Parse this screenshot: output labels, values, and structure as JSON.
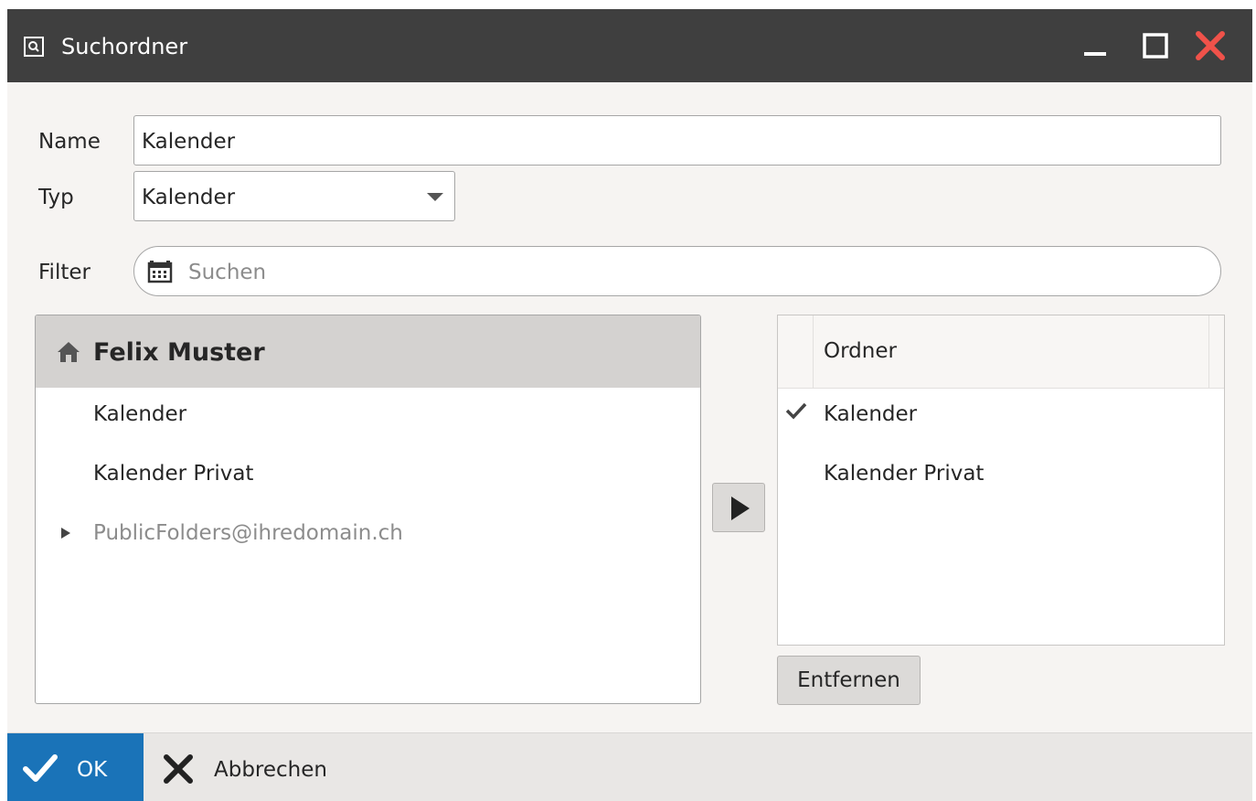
{
  "window": {
    "title": "Suchordner",
    "icon": "search-folder-icon",
    "controls": [
      "minimize-icon",
      "maximize-icon",
      "close-icon"
    ],
    "colors": {
      "titlebar": "#3f3f3f",
      "close": "#f0524a",
      "accent": "#1a73b8"
    }
  },
  "form": {
    "name_label": "Name",
    "name_value": "Kalender",
    "type_label": "Typ",
    "type_value": "Kalender",
    "filter_label": "Filter",
    "filter_placeholder": "Suchen",
    "filter_icon": "calendar-icon"
  },
  "tree": {
    "root": {
      "label": "Felix Muster",
      "icon": "home-icon"
    },
    "items": [
      {
        "label": "Kalender",
        "muted": false,
        "expandable": false
      },
      {
        "label": "Kalender Privat",
        "muted": false,
        "expandable": false
      },
      {
        "label": "PublicFolders@ihredomain.ch",
        "muted": true,
        "expandable": true
      }
    ]
  },
  "add_button": {
    "icon": "play-icon"
  },
  "selected": {
    "column": "Ordner",
    "rows": [
      {
        "label": "Kalender",
        "checked": true
      },
      {
        "label": "Kalender Privat",
        "checked": false
      }
    ],
    "remove_label": "Entfernen"
  },
  "footer": {
    "ok_label": "OK",
    "cancel_label": "Abbrechen"
  }
}
